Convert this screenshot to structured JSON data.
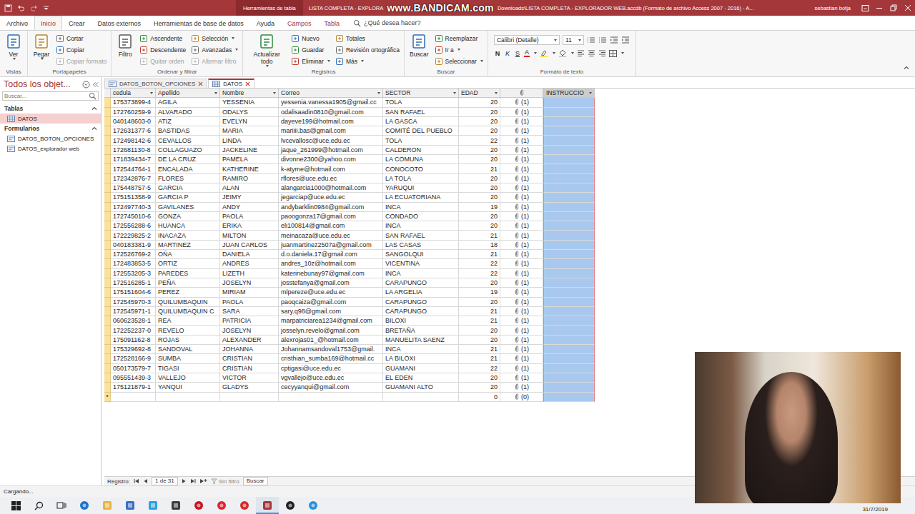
{
  "window": {
    "context_tab": "Herramientas de tabla",
    "title_left": "LISTA COMPLETA - EXPLORA",
    "watermark": "www.BANDICAM.com",
    "title_right": "Downloads\\LISTA COMPLETA - EXPLORADOR WEB.accdb (Formato de archivo Access 2007 - 2016) - A...",
    "user": "sebastian botja"
  },
  "ribbon_tabs": [
    {
      "label": "Archivo",
      "selected": false,
      "kind": "normal"
    },
    {
      "label": "Inicio",
      "selected": true,
      "kind": "normal"
    },
    {
      "label": "Crear",
      "selected": false,
      "kind": "normal"
    },
    {
      "label": "Datos externos",
      "selected": false,
      "kind": "normal"
    },
    {
      "label": "Herramientas de base de datos",
      "selected": false,
      "kind": "normal"
    },
    {
      "label": "Ayuda",
      "selected": false,
      "kind": "normal"
    },
    {
      "label": "Campos",
      "selected": false,
      "kind": "contextual"
    },
    {
      "label": "Tabla",
      "selected": false,
      "kind": "contextual"
    }
  ],
  "tell_me": "¿Qué desea hacer?",
  "ribbon_groups": [
    {
      "label": "Vistas",
      "items": [
        {
          "label": "Ver",
          "kind": "large",
          "dropdown": true,
          "disabled": false
        }
      ]
    },
    {
      "label": "Portapapeles",
      "items": [
        {
          "label": "Pegar",
          "kind": "large",
          "dropdown": true,
          "disabled": false
        },
        {
          "label": "Cortar",
          "kind": "small",
          "dropdown": false,
          "disabled": false
        },
        {
          "label": "Copiar",
          "kind": "small",
          "dropdown": false,
          "disabled": false
        },
        {
          "label": "Copiar formato",
          "kind": "small",
          "dropdown": false,
          "disabled": true
        }
      ]
    },
    {
      "label": "Ordenar y filtrar",
      "items": [
        {
          "label": "Filtro",
          "kind": "large",
          "dropdown": false,
          "disabled": false
        },
        {
          "label": "Ascendente",
          "kind": "small",
          "dropdown": false,
          "disabled": false
        },
        {
          "label": "Descendente",
          "kind": "small",
          "dropdown": false,
          "disabled": false
        },
        {
          "label": "Quitar orden",
          "kind": "small",
          "dropdown": false,
          "disabled": true
        },
        {
          "label": "Selección",
          "kind": "small",
          "dropdown": true,
          "disabled": false
        },
        {
          "label": "Avanzadas",
          "kind": "small",
          "dropdown": true,
          "disabled": false
        },
        {
          "label": "Alternar filtro",
          "kind": "small",
          "dropdown": false,
          "disabled": true
        }
      ]
    },
    {
      "label": "Registros",
      "items": [
        {
          "label": "Actualizar todo",
          "kind": "large",
          "dropdown": true,
          "disabled": false
        },
        {
          "label": "Nuevo",
          "kind": "small",
          "dropdown": false,
          "disabled": false
        },
        {
          "label": "Guardar",
          "kind": "small",
          "dropdown": false,
          "disabled": false
        },
        {
          "label": "Eliminar",
          "kind": "small",
          "dropdown": true,
          "disabled": false
        },
        {
          "label": "Totales",
          "kind": "small",
          "dropdown": false,
          "disabled": false
        },
        {
          "label": "Revisión ortográfica",
          "kind": "small",
          "dropdown": false,
          "disabled": false
        },
        {
          "label": "Más",
          "kind": "small",
          "dropdown": true,
          "disabled": false
        }
      ]
    },
    {
      "label": "Buscar",
      "items": [
        {
          "label": "Buscar",
          "kind": "large",
          "dropdown": false,
          "disabled": false
        },
        {
          "label": "Reemplazar",
          "kind": "small",
          "dropdown": false,
          "disabled": false
        },
        {
          "label": "Ir a",
          "kind": "small",
          "dropdown": true,
          "disabled": false
        },
        {
          "label": "Seleccionar",
          "kind": "small",
          "dropdown": true,
          "disabled": false
        }
      ]
    }
  ],
  "text_format": {
    "label": "Formato de texto",
    "font": "Calibri (Detalle)",
    "size": "11",
    "styles": [
      "N",
      "K",
      "S"
    ],
    "font_color": "A"
  },
  "nav_pane": {
    "title": "Todos los objet...",
    "search_placeholder": "Buscar...",
    "sections": [
      {
        "label": "Tablas",
        "expanded": true,
        "kind": "table",
        "items": [
          {
            "label": "DATOS",
            "selected": true
          }
        ]
      },
      {
        "label": "Formularios",
        "expanded": true,
        "kind": "form",
        "items": [
          {
            "label": "DATOS_BOTON_OPCIONES",
            "selected": false
          },
          {
            "label": "DATOS_explorador web",
            "selected": false
          }
        ]
      }
    ]
  },
  "doc_tabs": [
    {
      "label": "DATOS_BOTON_OPCIONES",
      "selected": false,
      "kind": "form"
    },
    {
      "label": "DATOS",
      "selected": true,
      "kind": "table"
    }
  ],
  "table": {
    "columns": [
      {
        "label": "cedula",
        "kind": "text",
        "selected": false
      },
      {
        "label": "Apellido",
        "kind": "text",
        "selected": false
      },
      {
        "label": "Nombre",
        "kind": "text",
        "selected": false
      },
      {
        "label": "Correo",
        "kind": "text",
        "selected": false
      },
      {
        "label": "SECTOR",
        "kind": "text",
        "selected": false
      },
      {
        "label": "EDAD",
        "kind": "number",
        "selected": false
      },
      {
        "kind": "attachment",
        "selected": false
      },
      {
        "label": "INSTRUCCIO",
        "kind": "text",
        "selected": true
      }
    ],
    "rows": [
      [
        "175373899-4",
        "AGILA",
        "YESSENIA",
        "yessenia.vanessa1905@gmail.cc",
        "TOLA",
        "20",
        "(1)",
        ""
      ],
      [
        "172760259-9",
        "ALVARADO",
        "ODALYS",
        "odalisaadin0810@gmail.com",
        "SAN RAFAEL",
        "20",
        "(1)",
        ""
      ],
      [
        "040148603-0",
        "ATIZ",
        "EVELYN",
        "dayeve199@hotmail.com",
        "LA GASCA",
        "20",
        "(1)",
        ""
      ],
      [
        "172631377-6",
        "BASTIDAS",
        "MARIA",
        "mariiii.bas@gmail.com",
        "COMITÉ DEL PUEBLO",
        "20",
        "(1)",
        ""
      ],
      [
        "172498142-6",
        "CEVALLOS",
        "LINDA",
        "lvcevallosc@uce.edu.ec",
        "TOLA",
        "22",
        "(1)",
        ""
      ],
      [
        "172681130-8",
        "COLLAGUAZO",
        "JACKELINE",
        "jaque_261999@hotmail.com",
        "CALDERON",
        "20",
        "(1)",
        ""
      ],
      [
        "171839434-7",
        "DE LA CRUZ",
        "PAMELA",
        "divonne2300@yahoo.com",
        "LA COMUNA",
        "20",
        "(1)",
        ""
      ],
      [
        "172544764-1",
        "ENCALADA",
        "KATHERINE",
        "k-atyme@hotmail.com",
        "CONOCOTO",
        "21",
        "(1)",
        ""
      ],
      [
        "172342876-7",
        "FLORES",
        "RAMIRO",
        "rflores@uce.edu.ec",
        "LA TOLA",
        "20",
        "(1)",
        ""
      ],
      [
        "175448757-5",
        "GARCIA",
        "ALAN",
        "alangarcia1000@hotmail.com",
        "YARUQUI",
        "20",
        "(1)",
        ""
      ],
      [
        "175151358-9",
        "GARCIA P",
        "JEIMY",
        "jegarciap@uce.edu.ec",
        "LA ECUATORIANA",
        "20",
        "(1)",
        ""
      ],
      [
        "172497740-3",
        "GAVILANES",
        "ANDY",
        "andybarklin0984@gmail.com",
        "INCA",
        "19",
        "(1)",
        ""
      ],
      [
        "172745010-6",
        "GONZA",
        "PAOLA",
        "paoogonza17@gmail.com",
        "CONDADO",
        "20",
        "(1)",
        ""
      ],
      [
        "172556288-6",
        "HUANCA",
        "ERIKA",
        "eli100814@gmail.com",
        "INCA",
        "20",
        "(1)",
        ""
      ],
      [
        "172229825-2",
        "INACAZA",
        "MILTON",
        "meinacaza@uce.edu.ec",
        "SAN RAFAEL",
        "21",
        "(1)",
        ""
      ],
      [
        "040183381-9",
        "MARTINEZ",
        "JUAN CARLOS",
        "juanmartinez2507a@gmail.com",
        "LAS CASAS",
        "18",
        "(1)",
        ""
      ],
      [
        "172526769-2",
        "OÑA",
        "DANIELA",
        "d.o.daniela.17@gmail.com",
        "SANGOLQUI",
        "21",
        "(1)",
        ""
      ],
      [
        "172483853-5",
        "ORTIZ",
        "ANDRES",
        "andres_10z@hotmail.com",
        "VICENTINA",
        "22",
        "(1)",
        ""
      ],
      [
        "172553205-3",
        "PAREDES",
        "LIZETH",
        "katerinebunay97@gmail.com",
        "INCA",
        "22",
        "(1)",
        ""
      ],
      [
        "172516285-1",
        "PEÑA",
        "JOSELYN",
        "josstefanya@gmail.com",
        "CARAPUNGO",
        "20",
        "(1)",
        ""
      ],
      [
        "175151604-6",
        "PEREZ",
        "MIRIAM",
        "mlpereze@uce.edu.ec",
        "LA ARGELIA",
        "19",
        "(1)",
        ""
      ],
      [
        "172545970-3",
        "QUILUMBAQUIN",
        "PAOLA",
        "paoqcaiza@gmail.com",
        "CARAPUNGO",
        "20",
        "(1)",
        ""
      ],
      [
        "172545971-1",
        "QUILUMBAQUIN C",
        "SARA",
        "sary.q98@gmail.com",
        "CARAPUNGO",
        "21",
        "(1)",
        ""
      ],
      [
        "060623528-1",
        "REA",
        "PATRICIA",
        "marpatriciarea1234@gmail.com",
        "BILOXI",
        "21",
        "(1)",
        ""
      ],
      [
        "172252237-0",
        "REVELO",
        "JOSELYN",
        "josselyn.revelo@gmail.com",
        "BRETAÑA",
        "20",
        "(1)",
        ""
      ],
      [
        "175091162-8",
        "ROJAS",
        "ALEXANDER",
        "alexrojas01_@hotmail.com",
        "MANUELITA SAENZ",
        "20",
        "(1)",
        ""
      ],
      [
        "175329692-8",
        "SANDOVAL",
        "JOHANNA",
        "Johannamsandoval1753@gmail.",
        "INCA",
        "21",
        "(1)",
        ""
      ],
      [
        "172528166-9",
        "SUMBA",
        "CRISTIAN",
        "cristhian_sumba169@hotmail.cc",
        "LA BILOXI",
        "21",
        "(1)",
        ""
      ],
      [
        "050173579-7",
        "TIGASI",
        "CRISTIAN",
        "cptigasi@uce.edu.ec",
        "GUAMANI",
        "22",
        "(1)",
        ""
      ],
      [
        "095551439-3",
        "VALLEJO",
        "VICTOR",
        "vgvallejo@uce.edu.ec",
        "EL EDEN",
        "20",
        "(1)",
        ""
      ],
      [
        "175121879-1",
        "YANQUI",
        "GLADYS",
        "cecyyanqui@gmail.com",
        "GUAMANI ALTO",
        "20",
        "(1)",
        ""
      ]
    ],
    "new_row": {
      "marker": "*",
      "cells": [
        "",
        "",
        "",
        "",
        "",
        "0",
        "(0)",
        ""
      ]
    }
  },
  "record_nav": {
    "label": "Registro:",
    "position": "1 de 31",
    "filter": "Sin filtro",
    "search": "Buscar"
  },
  "status_bar": "Cargando...",
  "taskbar": {
    "apps": [
      {
        "kind": "windows",
        "color": "#1f1f1f",
        "active": false
      },
      {
        "kind": "search",
        "color": "#1f1f1f",
        "active": false
      },
      {
        "kind": "taskview",
        "color": "#1f1f1f",
        "active": false
      },
      {
        "kind": "circle",
        "color": "#1e73c8",
        "active": false
      },
      {
        "kind": "square",
        "color": "#e8b43a",
        "active": false
      },
      {
        "kind": "square",
        "color": "#3a6fc2",
        "active": false
      },
      {
        "kind": "square",
        "color": "#2aa0df",
        "active": false
      },
      {
        "kind": "square",
        "color": "#3c3c3c",
        "active": false
      },
      {
        "kind": "circle",
        "color": "#c8161d",
        "active": false
      },
      {
        "kind": "circle",
        "color": "#e3232e",
        "active": false
      },
      {
        "kind": "circle",
        "color": "#d42b2b",
        "active": false
      },
      {
        "kind": "square",
        "color": "#a4373a",
        "active": true
      },
      {
        "kind": "circle",
        "color": "#222222",
        "active": false
      },
      {
        "kind": "circle",
        "color": "#2690e0",
        "active": false
      }
    ],
    "date": "31/7/2019"
  }
}
